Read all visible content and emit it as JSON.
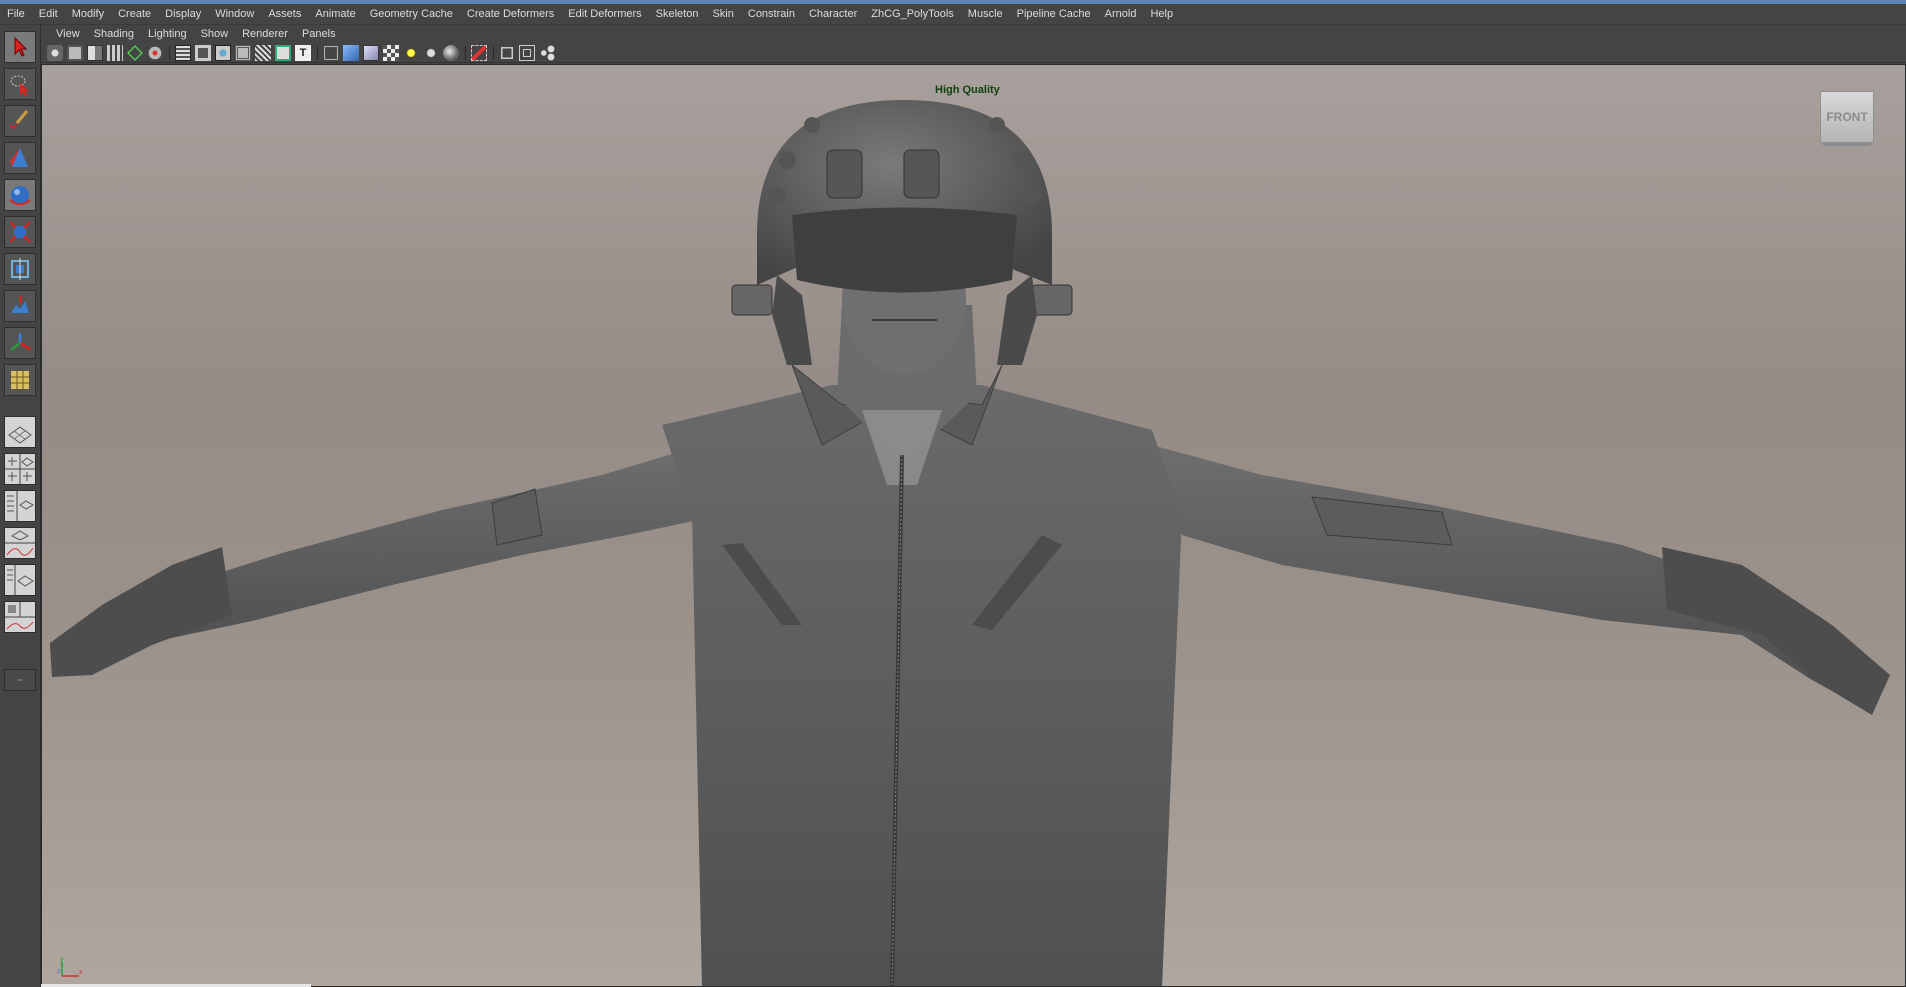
{
  "menubar": {
    "items": [
      "File",
      "Edit",
      "Modify",
      "Create",
      "Display",
      "Window",
      "Assets",
      "Animate",
      "Geometry Cache",
      "Create Deformers",
      "Edit Deformers",
      "Skeleton",
      "Skin",
      "Constrain",
      "Character",
      "ZhCG_PolyTools",
      "Muscle",
      "Pipeline Cache",
      "Arnold",
      "Help"
    ]
  },
  "toolbox": {
    "tools": [
      "select-tool",
      "lasso-tool",
      "paint-select-tool",
      "move-tool",
      "rotate-tool",
      "scale-tool",
      "universal-manipulator-tool",
      "soft-modification-tool",
      "show-manipulator-tool",
      "last-used-tool"
    ],
    "layouts": [
      "single-perspective-layout",
      "four-view-layout",
      "perspective-outliner-layout",
      "perspective-graph-layout",
      "outliner-perspective-layout",
      "hypershade-perspective-layout"
    ]
  },
  "panel": {
    "menus": [
      "View",
      "Shading",
      "Lighting",
      "Show",
      "Renderer",
      "Panels"
    ]
  },
  "viewport": {
    "quality_label": "High Quality",
    "viewcube_label": "FRONT",
    "axis": {
      "y": "y",
      "z": "z",
      "x": "x"
    },
    "colors": {
      "quality_label": "#13400f"
    }
  },
  "icons": {
    "panel_toolbar": [
      "camera-attributes-icon",
      "bookmark-icon",
      "image-plane-icon",
      "film-gate-icon",
      "grease-pencil-icon",
      "grid-icon",
      "resolution-gate-icon",
      "gate-mask-icon",
      "field-chart-icon",
      "safe-action-icon",
      "safe-title-icon",
      "wireframe-icon",
      "smooth-shade-icon",
      "wireframe-on-shaded-icon",
      "textured-icon",
      "use-all-lights-icon",
      "shadows-icon",
      "ambient-occlusion-icon",
      "isolate-select-icon",
      "xray-icon",
      "xray-joints-icon",
      "hud-icon"
    ]
  }
}
